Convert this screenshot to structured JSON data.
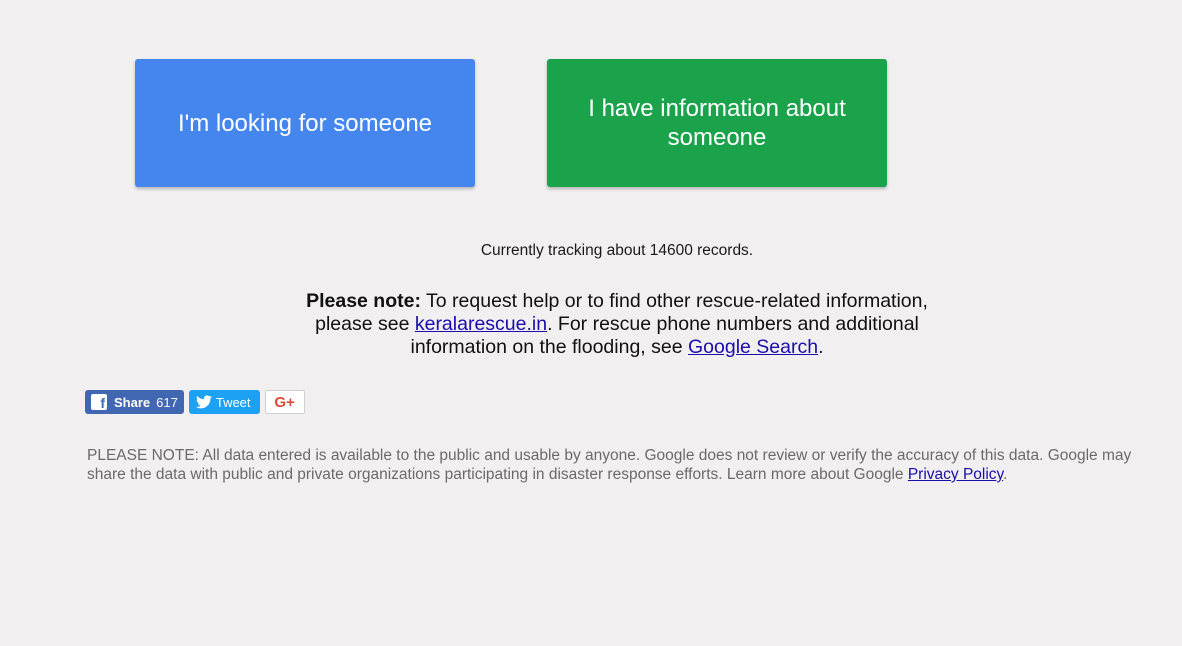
{
  "buttons": {
    "seeking_label": "I'm looking for someone",
    "info_label": "I have information about someone"
  },
  "tracking_text": "Currently tracking about 14600 records.",
  "note": {
    "bold_prefix": "Please note:",
    "text_1": " To request help or to find other rescue-related information, please see ",
    "link_1": "keralarescue.in",
    "text_2": ". For rescue phone numbers and additional information on the flooding, see ",
    "link_2": "Google Search",
    "text_3": "."
  },
  "social": {
    "fb_label": "Share",
    "fb_count": "617",
    "tweet_label": "Tweet",
    "gplus_label": "G+"
  },
  "footer": {
    "text": "PLEASE NOTE: All data entered is available to the public and usable by anyone. Google does not review or verify the accuracy of this data. Google may share the data with public and private organizations participating in disaster response efforts. Learn more about Google ",
    "link": "Privacy Policy",
    "end": "."
  },
  "colors": {
    "background": "#f1eff0",
    "seek_button": "#4586ee",
    "info_button": "#1aa34b",
    "link": "#1a0dab",
    "facebook": "#4267b2",
    "twitter": "#1da1f2",
    "gplus": "#dd4b39"
  }
}
